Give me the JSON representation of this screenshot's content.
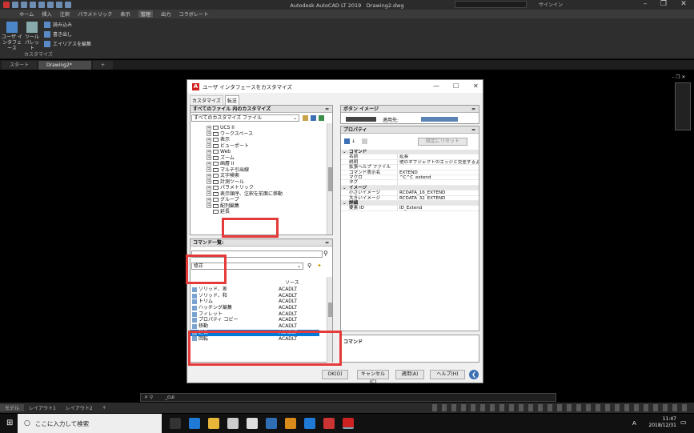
{
  "app": {
    "title": "Autodesk AutoCAD LT 2019　Drawing2.dwg",
    "signin": "サインイン"
  },
  "menu": [
    "ホーム",
    "挿入",
    "注釈",
    "パラメトリック",
    "表示",
    "管理",
    "出力",
    "コラボレート"
  ],
  "menu_active_index": 5,
  "ribbon": {
    "cui_label": "ユーザ インタフェース",
    "toolpalette_label": "ツール パレット",
    "import_label": "読み込み",
    "export_label": "書き出し",
    "alias_label": "エイリアスを編集",
    "group_label": "カスタマイズ"
  },
  "file_tabs": [
    {
      "label": "スタート"
    },
    {
      "label": "Drawing2*"
    }
  ],
  "dialog": {
    "title": "ユーザ インタフェースをカスタマイズ",
    "tabs": [
      "カスタマイズ",
      "転送"
    ],
    "customize_panel": {
      "header": "すべてのファイル 内のカスタマイズ",
      "combo": "すべてのカスタマイズ ファイル",
      "tree": [
        "UCS II",
        "ワークスペース",
        "表示",
        "ビューポート",
        "Web",
        "ズーム",
        "画層 II",
        "マルチ引出線",
        "文字検索",
        "計測ツール",
        "パラメトリック",
        "表示順序、注釈を前面に移動",
        "グループ",
        "配列編集",
        "延長"
      ]
    },
    "command_panel": {
      "header": "コマンド一覧:",
      "search": "",
      "filter": "修正",
      "col_source": "ソース",
      "rows": [
        {
          "name": "ソリッド、差",
          "source": "ACADLT"
        },
        {
          "name": "ソリッド、和",
          "source": "ACADLT"
        },
        {
          "name": "トリム",
          "source": "ACADLT"
        },
        {
          "name": "ハッチング編集",
          "source": "ACADLT"
        },
        {
          "name": "フィレット",
          "source": "ACADLT"
        },
        {
          "name": "プロパティ コピー",
          "source": "ACADLT"
        },
        {
          "name": "移動",
          "source": "ACADLT"
        },
        {
          "name": "延長",
          "source": "ACADLT"
        },
        {
          "name": "回転",
          "source": "ACADLT"
        }
      ],
      "selected_index": 7
    },
    "button_image_panel": {
      "header": "ボタン イメージ",
      "apply_label": "適用先:"
    },
    "properties_panel": {
      "header": "プロパティ",
      "reset_label": "既定にリセット",
      "rows": [
        {
          "cat": true,
          "k": "コマンド",
          "v": ""
        },
        {
          "k": "名前",
          "v": "延長"
        },
        {
          "k": "説明",
          "v": "他のオブジェクトのエッジと交差するようにオ"
        },
        {
          "k": "拡張ヘルプ ファイル",
          "v": ""
        },
        {
          "k": "コマンド表示名",
          "v": "EXTEND"
        },
        {
          "k": "マクロ",
          "v": "^C^C_extend"
        },
        {
          "k": "タグ",
          "v": ""
        },
        {
          "cat": true,
          "k": "イメージ",
          "v": ""
        },
        {
          "k": "小さいイメージ",
          "v": "RCDATA_16_EXTEND"
        },
        {
          "k": "大きいイメージ",
          "v": "RCDATA_32_EXTEND"
        },
        {
          "cat": true,
          "k": "詳細",
          "v": ""
        },
        {
          "k": "要素 ID",
          "v": "ID_Extend"
        }
      ]
    },
    "description_panel": {
      "header": "コマンド"
    },
    "buttons": {
      "ok": "OK(O)",
      "cancel": "キャンセル(C)",
      "apply": "適用(A)",
      "help": "ヘルプ(H)"
    }
  },
  "command_line": {
    "text": "_cui"
  },
  "layout_tabs": [
    "モデル",
    "レイアウト1",
    "レイアウト2"
  ],
  "taskbar": {
    "search": "ここに入力して検索",
    "time": "11:47",
    "date": "2018/12/31",
    "ime": "A"
  }
}
